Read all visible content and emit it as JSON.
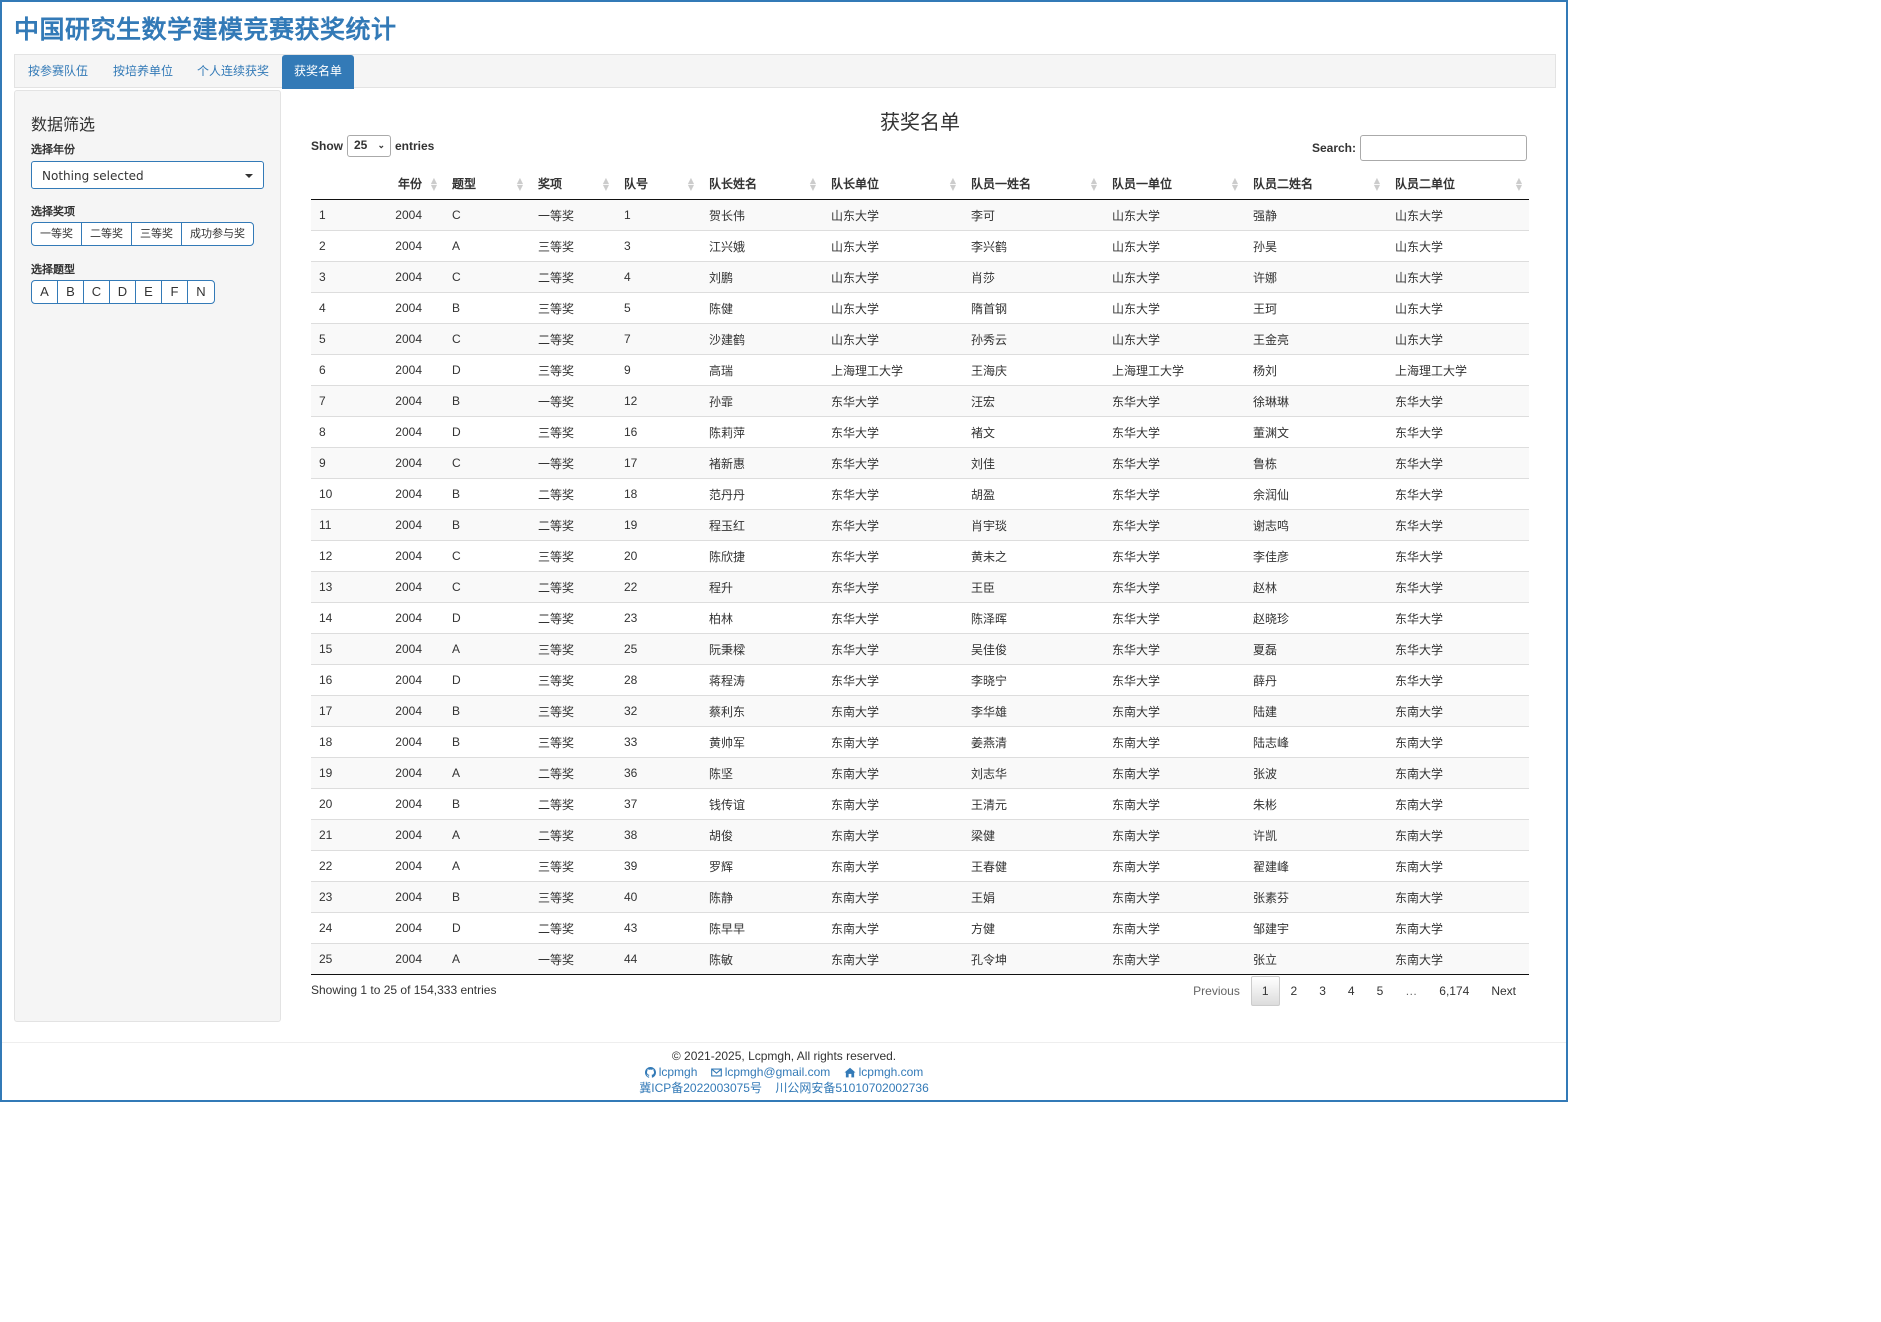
{
  "site_title": "中国研究生数学建模竞赛获奖统计",
  "tabs": [
    "按参赛队伍",
    "按培养单位",
    "个人连续获奖",
    "获奖名单"
  ],
  "active_tab_index": 3,
  "sidebar": {
    "heading": "数据筛选",
    "year_label": "选择年份",
    "year_select": "Nothing selected",
    "award_label": "选择奖项",
    "awards": [
      "一等奖",
      "二等奖",
      "三等奖",
      "成功参与奖"
    ],
    "type_label": "选择题型",
    "types": [
      "A",
      "B",
      "C",
      "D",
      "E",
      "F",
      "N"
    ]
  },
  "main_title": "获奖名单",
  "length_control": {
    "show": "Show",
    "value": "25",
    "entries": "entries"
  },
  "search_label": "Search:",
  "columns": [
    "",
    "年份",
    "题型",
    "奖项",
    "队号",
    "队长姓名",
    "队长单位",
    "队员一姓名",
    "队员一单位",
    "队员二姓名",
    "队员二单位"
  ],
  "rows": [
    [
      "1",
      "2004",
      "C",
      "一等奖",
      "1",
      "贺长伟",
      "山东大学",
      "李可",
      "山东大学",
      "强静",
      "山东大学"
    ],
    [
      "2",
      "2004",
      "A",
      "三等奖",
      "3",
      "江兴娥",
      "山东大学",
      "李兴鹤",
      "山东大学",
      "孙昊",
      "山东大学"
    ],
    [
      "3",
      "2004",
      "C",
      "二等奖",
      "4",
      "刘鹏",
      "山东大学",
      "肖莎",
      "山东大学",
      "许娜",
      "山东大学"
    ],
    [
      "4",
      "2004",
      "B",
      "三等奖",
      "5",
      "陈健",
      "山东大学",
      "隋首钢",
      "山东大学",
      "王珂",
      "山东大学"
    ],
    [
      "5",
      "2004",
      "C",
      "二等奖",
      "7",
      "沙建鹤",
      "山东大学",
      "孙秀云",
      "山东大学",
      "王金亮",
      "山东大学"
    ],
    [
      "6",
      "2004",
      "D",
      "三等奖",
      "9",
      "高瑞",
      "上海理工大学",
      "王海庆",
      "上海理工大学",
      "杨刘",
      "上海理工大学"
    ],
    [
      "7",
      "2004",
      "B",
      "一等奖",
      "12",
      "孙霏",
      "东华大学",
      "汪宏",
      "东华大学",
      "徐琳琳",
      "东华大学"
    ],
    [
      "8",
      "2004",
      "D",
      "三等奖",
      "16",
      "陈莉萍",
      "东华大学",
      "褚文",
      "东华大学",
      "董渊文",
      "东华大学"
    ],
    [
      "9",
      "2004",
      "C",
      "一等奖",
      "17",
      "褚新惠",
      "东华大学",
      "刘佳",
      "东华大学",
      "鲁栋",
      "东华大学"
    ],
    [
      "10",
      "2004",
      "B",
      "二等奖",
      "18",
      "范丹丹",
      "东华大学",
      "胡盈",
      "东华大学",
      "余润仙",
      "东华大学"
    ],
    [
      "11",
      "2004",
      "B",
      "二等奖",
      "19",
      "程玉红",
      "东华大学",
      "肖宇琰",
      "东华大学",
      "谢志鸣",
      "东华大学"
    ],
    [
      "12",
      "2004",
      "C",
      "三等奖",
      "20",
      "陈欣捷",
      "东华大学",
      "黄未之",
      "东华大学",
      "李佳彦",
      "东华大学"
    ],
    [
      "13",
      "2004",
      "C",
      "二等奖",
      "22",
      "程升",
      "东华大学",
      "王臣",
      "东华大学",
      "赵林",
      "东华大学"
    ],
    [
      "14",
      "2004",
      "D",
      "二等奖",
      "23",
      "柏林",
      "东华大学",
      "陈泽晖",
      "东华大学",
      "赵晓珍",
      "东华大学"
    ],
    [
      "15",
      "2004",
      "A",
      "三等奖",
      "25",
      "阮秉樑",
      "东华大学",
      "吴佳俊",
      "东华大学",
      "夏磊",
      "东华大学"
    ],
    [
      "16",
      "2004",
      "D",
      "三等奖",
      "28",
      "蒋程涛",
      "东华大学",
      "李晓宁",
      "东华大学",
      "薛丹",
      "东华大学"
    ],
    [
      "17",
      "2004",
      "B",
      "三等奖",
      "32",
      "蔡利东",
      "东南大学",
      "李华雄",
      "东南大学",
      "陆建",
      "东南大学"
    ],
    [
      "18",
      "2004",
      "B",
      "三等奖",
      "33",
      "黄帅军",
      "东南大学",
      "姜燕清",
      "东南大学",
      "陆志峰",
      "东南大学"
    ],
    [
      "19",
      "2004",
      "A",
      "二等奖",
      "36",
      "陈坚",
      "东南大学",
      "刘志华",
      "东南大学",
      "张波",
      "东南大学"
    ],
    [
      "20",
      "2004",
      "B",
      "二等奖",
      "37",
      "钱传谊",
      "东南大学",
      "王清元",
      "东南大学",
      "朱彬",
      "东南大学"
    ],
    [
      "21",
      "2004",
      "A",
      "二等奖",
      "38",
      "胡俊",
      "东南大学",
      "梁健",
      "东南大学",
      "许凯",
      "东南大学"
    ],
    [
      "22",
      "2004",
      "A",
      "三等奖",
      "39",
      "罗辉",
      "东南大学",
      "王春健",
      "东南大学",
      "翟建峰",
      "东南大学"
    ],
    [
      "23",
      "2004",
      "B",
      "三等奖",
      "40",
      "陈静",
      "东南大学",
      "王娟",
      "东南大学",
      "张素芬",
      "东南大学"
    ],
    [
      "24",
      "2004",
      "D",
      "二等奖",
      "43",
      "陈早早",
      "东南大学",
      "方健",
      "东南大学",
      "邹建宇",
      "东南大学"
    ],
    [
      "25",
      "2004",
      "A",
      "一等奖",
      "44",
      "陈敏",
      "东南大学",
      "孔令坤",
      "东南大学",
      "张立",
      "东南大学"
    ]
  ],
  "info": "Showing 1 to 25 of 154,333 entries",
  "pagination": {
    "previous": "Previous",
    "pages": [
      "1",
      "2",
      "3",
      "4",
      "5",
      "…",
      "6,174"
    ],
    "current": "1",
    "next": "Next"
  },
  "footer": {
    "copyright": "© 2021-2025, Lcpmgh, All rights reserved.",
    "github": "lcpmgh",
    "email": "lcpmgh@gmail.com",
    "site": "lcpmgh.com",
    "icp": "冀ICP备2022003075号",
    "police": "川公网安备51010702002736"
  },
  "colors": {
    "accent": "#337ab7",
    "panel": "#f5f5f5",
    "stripe": "#f9f9f9"
  },
  "icons": {
    "github": "github-icon",
    "email": "envelope-icon",
    "site": "home-icon"
  }
}
